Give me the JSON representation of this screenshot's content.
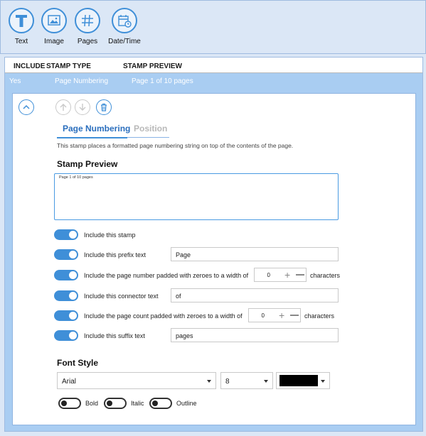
{
  "toolbar": {
    "buttons": [
      {
        "label": "Text",
        "icon": "text-icon"
      },
      {
        "label": "Image",
        "icon": "image-icon"
      },
      {
        "label": "Pages",
        "icon": "hash-icon"
      },
      {
        "label": "Date/Time",
        "icon": "calendar-clock-icon"
      }
    ]
  },
  "table": {
    "headers": [
      "INCLUDE",
      "STAMP TYPE",
      "STAMP PREVIEW"
    ],
    "row": {
      "include": "Yes",
      "type": "Page Numbering",
      "preview": "Page 1 of 10 pages"
    }
  },
  "detail": {
    "tabs": {
      "active": "Page Numbering",
      "inactive": "Position"
    },
    "description": "This stamp places a formatted page numbering string on top of the contents of the page.",
    "preview_heading": "Stamp Preview",
    "preview_text": "Page 1 of 10 pages",
    "options": {
      "include": "Include this stamp",
      "prefix_label": "Include this prefix text",
      "prefix_value": "Page",
      "number_label": "Include the page number padded with zeroes to a width of",
      "number_value": "0",
      "number_suffix": "characters",
      "connector_label": "Include this connector text",
      "connector_value": "of",
      "count_label": "Include the page count padded with zeroes to a width of",
      "count_value": "0",
      "count_suffix": "characters",
      "suffix_label": "Include this suffix text",
      "suffix_value": "pages"
    },
    "font_heading": "Font Style",
    "font_family": "Arial",
    "font_size": "8",
    "font_color": "#000000",
    "style_toggles": {
      "bold": "Bold",
      "italic": "Italic",
      "outline": "Outline"
    }
  },
  "colors": {
    "accent": "#3f8fd8",
    "selection": "#a9cdf2"
  }
}
